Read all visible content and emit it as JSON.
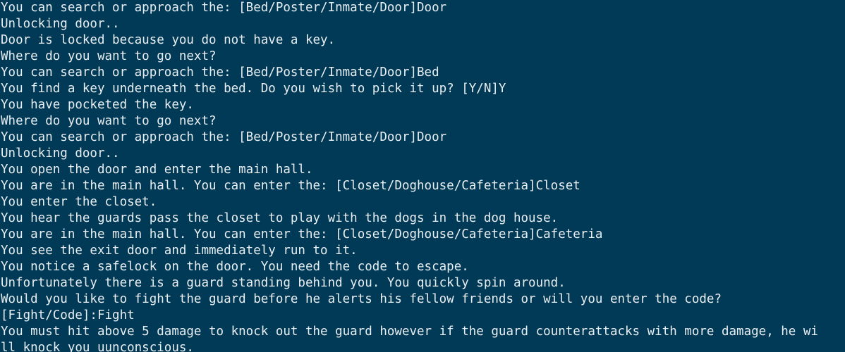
{
  "terminal": {
    "lines": [
      "You can search or approach the: [Bed/Poster/Inmate/Door]Door",
      "Unlocking door..",
      "Door is locked because you do not have a key.",
      "Where do you want to go next?",
      "You can search or approach the: [Bed/Poster/Inmate/Door]Bed",
      "You find a key underneath the bed. Do you wish to pick it up? [Y/N]Y",
      "You have pocketed the key.",
      "Where do you want to go next?",
      "You can search or approach the: [Bed/Poster/Inmate/Door]Door",
      "Unlocking door..",
      "You open the door and enter the main hall.",
      "You are in the main hall. You can enter the: [Closet/Doghouse/Cafeteria]Closet",
      "You enter the closet.",
      "You hear the guards pass the closet to play with the dogs in the dog house.",
      "You are in the main hall. You can enter the: [Closet/Doghouse/Cafeteria]Cafeteria",
      "You see the exit door and immediately run to it.",
      "You notice a safelock on the door. You need the code to escape.",
      "Unfortunately there is a guard standing behind you. You quickly spin around.",
      "Would you like to fight the guard before he alerts his fellow friends or will you enter the code?",
      "[Fight/Code]:Fight",
      "You must hit above 5 damage to knock out the guard however if the guard counterattacks with more damage, he wi",
      "ll knock you uunconscious."
    ]
  }
}
